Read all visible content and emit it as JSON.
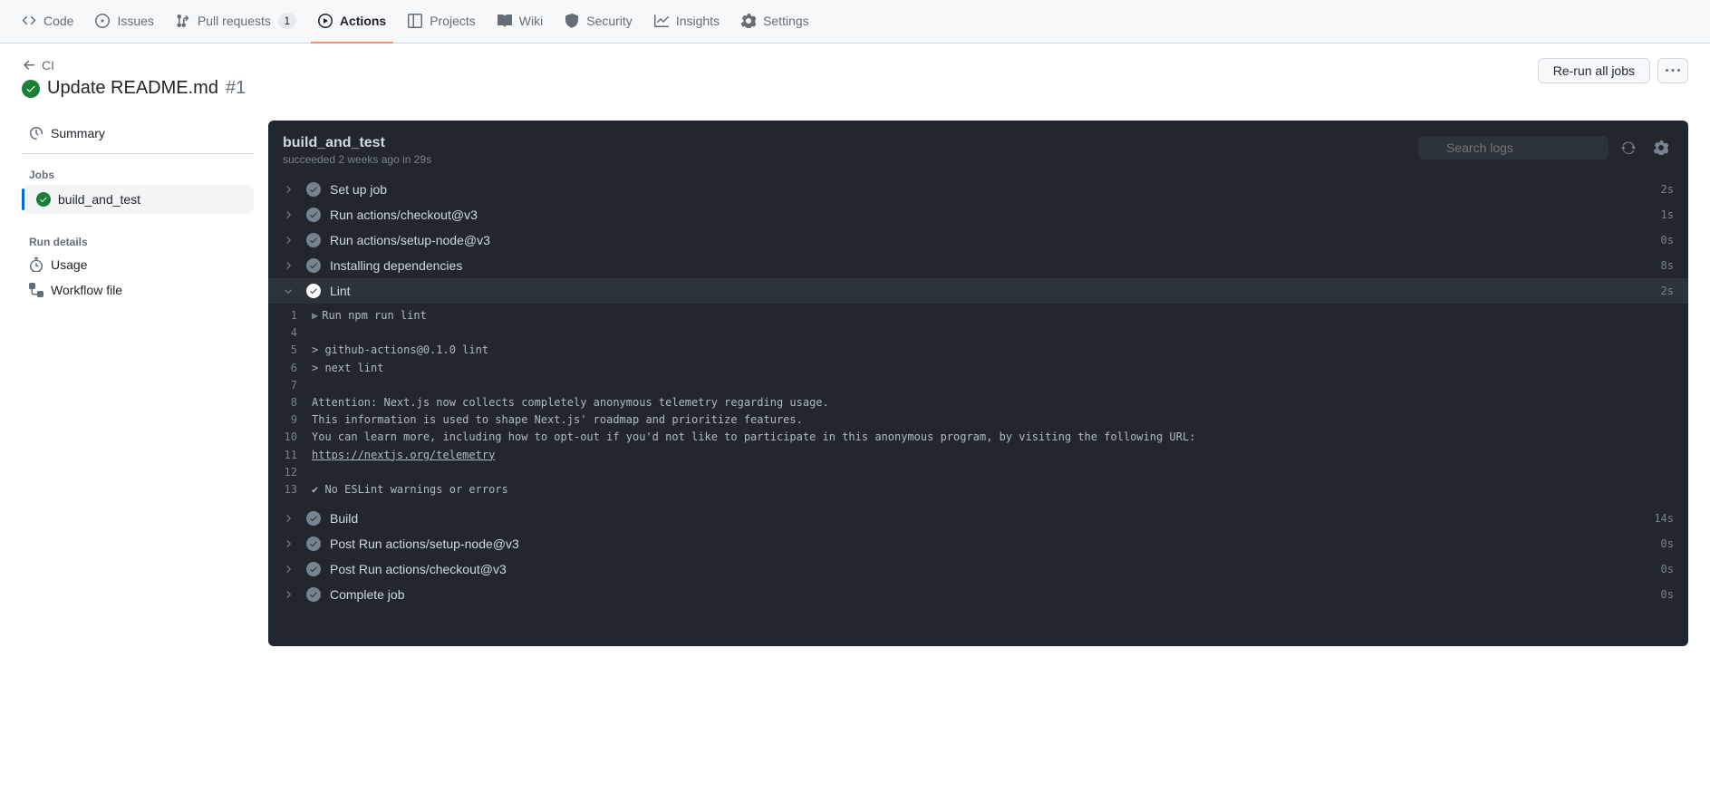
{
  "tabs": {
    "code": "Code",
    "issues": "Issues",
    "pulls": "Pull requests",
    "pulls_count": "1",
    "actions": "Actions",
    "projects": "Projects",
    "wiki": "Wiki",
    "security": "Security",
    "insights": "Insights",
    "settings": "Settings"
  },
  "breadcrumb": {
    "parent": "CI"
  },
  "run": {
    "title": "Update README.md",
    "number": "#1"
  },
  "header_actions": {
    "rerun": "Re-run all jobs"
  },
  "sidebar": {
    "summary": "Summary",
    "jobs_heading": "Jobs",
    "job_name": "build_and_test",
    "run_details_heading": "Run details",
    "usage": "Usage",
    "workflow_file": "Workflow file"
  },
  "job": {
    "name": "build_and_test",
    "status_text": "succeeded 2 weeks ago in 29s",
    "search_placeholder": "Search logs"
  },
  "steps": [
    {
      "name": "Set up job",
      "dur": "2s",
      "expanded": false
    },
    {
      "name": "Run actions/checkout@v3",
      "dur": "1s",
      "expanded": false
    },
    {
      "name": "Run actions/setup-node@v3",
      "dur": "0s",
      "expanded": false
    },
    {
      "name": "Installing dependencies",
      "dur": "8s",
      "expanded": false
    },
    {
      "name": "Lint",
      "dur": "2s",
      "expanded": true
    },
    {
      "name": "Build",
      "dur": "14s",
      "expanded": false
    },
    {
      "name": "Post Run actions/setup-node@v3",
      "dur": "0s",
      "expanded": false
    },
    {
      "name": "Post Run actions/checkout@v3",
      "dur": "0s",
      "expanded": false
    },
    {
      "name": "Complete job",
      "dur": "0s",
      "expanded": false
    }
  ],
  "log": {
    "lines": [
      {
        "n": "1",
        "text": "Run npm run lint",
        "caret": true
      },
      {
        "n": "4",
        "text": ""
      },
      {
        "n": "5",
        "text": "> github-actions@0.1.0 lint"
      },
      {
        "n": "6",
        "text": "> next lint"
      },
      {
        "n": "7",
        "text": ""
      },
      {
        "n": "8",
        "text": "Attention: Next.js now collects completely anonymous telemetry regarding usage."
      },
      {
        "n": "9",
        "text": "This information is used to shape Next.js' roadmap and prioritize features."
      },
      {
        "n": "10",
        "text": "You can learn more, including how to opt-out if you'd not like to participate in this anonymous program, by visiting the following URL:"
      },
      {
        "n": "11",
        "text": "https://nextjs.org/telemetry",
        "link": true
      },
      {
        "n": "12",
        "text": ""
      },
      {
        "n": "13",
        "text": "✔ No ESLint warnings or errors"
      }
    ]
  }
}
